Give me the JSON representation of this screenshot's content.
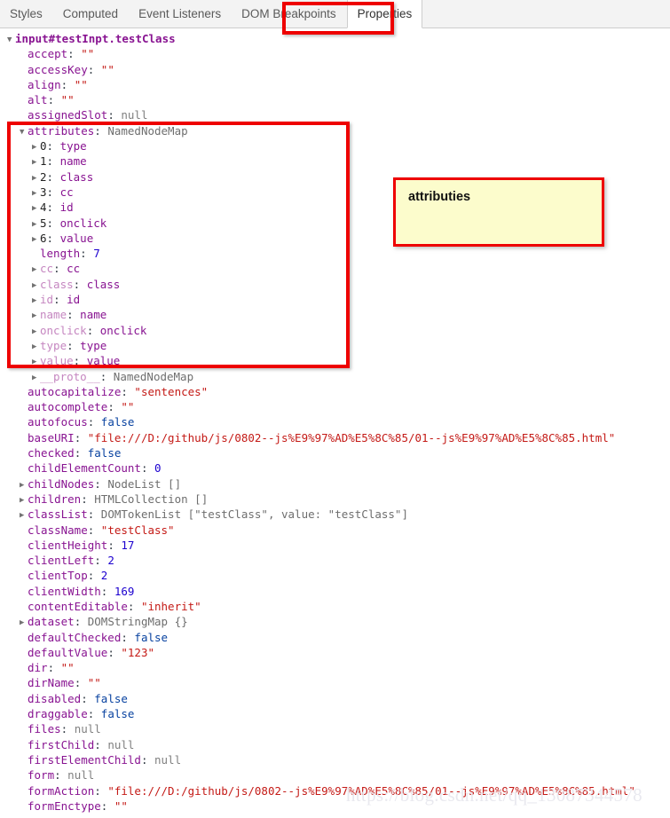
{
  "tabbar": {
    "tabs": [
      {
        "label": "Styles",
        "active": false
      },
      {
        "label": "Computed",
        "active": false
      },
      {
        "label": "Event Listeners",
        "active": false
      },
      {
        "label": "DOM Breakpoints",
        "active": false
      },
      {
        "label": "Properties",
        "active": true
      }
    ]
  },
  "note": {
    "text": "attributies"
  },
  "watermark": {
    "text": "https://blog.csdn.net/qq_13087344578"
  },
  "colors": {
    "annotation_red": "#ee0000",
    "note_fill": "#fcfccc",
    "key_purple": "#881391",
    "string_red": "#c41a16",
    "number_blue": "#1c00cf",
    "boolean_blue": "#0842a0",
    "null_gray": "#808080"
  },
  "tree": {
    "root": {
      "arrow": "open",
      "label": "input#testInpt.testClass"
    },
    "rows": [
      {
        "arrow": "none",
        "indent": 1,
        "keyClass": "k-name",
        "key": "accept",
        "sep": ": ",
        "valClass": "v-str",
        "val": "\"\""
      },
      {
        "arrow": "none",
        "indent": 1,
        "keyClass": "k-name",
        "key": "accessKey",
        "sep": ": ",
        "valClass": "v-str",
        "val": "\"\""
      },
      {
        "arrow": "none",
        "indent": 1,
        "keyClass": "k-name",
        "key": "align",
        "sep": ": ",
        "valClass": "v-str",
        "val": "\"\""
      },
      {
        "arrow": "none",
        "indent": 1,
        "keyClass": "k-name",
        "key": "alt",
        "sep": ": ",
        "valClass": "v-str",
        "val": "\"\""
      },
      {
        "arrow": "none",
        "indent": 1,
        "keyClass": "k-name",
        "key": "assignedSlot",
        "sep": ": ",
        "valClass": "v-null",
        "val": "null"
      },
      {
        "arrow": "open",
        "indent": 1,
        "keyClass": "k-name",
        "key": "attributes",
        "sep": ": ",
        "valClass": "v-obj",
        "val": "NamedNodeMap"
      },
      {
        "arrow": "closed",
        "indent": 2,
        "keyClass": "k-index",
        "key": "0",
        "sep": ": ",
        "valClass": "k-name",
        "val": "type"
      },
      {
        "arrow": "closed",
        "indent": 2,
        "keyClass": "k-index",
        "key": "1",
        "sep": ": ",
        "valClass": "k-name",
        "val": "name"
      },
      {
        "arrow": "closed",
        "indent": 2,
        "keyClass": "k-index",
        "key": "2",
        "sep": ": ",
        "valClass": "k-name",
        "val": "class"
      },
      {
        "arrow": "closed",
        "indent": 2,
        "keyClass": "k-index",
        "key": "3",
        "sep": ": ",
        "valClass": "k-name",
        "val": "cc"
      },
      {
        "arrow": "closed",
        "indent": 2,
        "keyClass": "k-index",
        "key": "4",
        "sep": ": ",
        "valClass": "k-name",
        "val": "id"
      },
      {
        "arrow": "closed",
        "indent": 2,
        "keyClass": "k-index",
        "key": "5",
        "sep": ": ",
        "valClass": "k-name",
        "val": "onclick"
      },
      {
        "arrow": "closed",
        "indent": 2,
        "keyClass": "k-index",
        "key": "6",
        "sep": ": ",
        "valClass": "k-name",
        "val": "value"
      },
      {
        "arrow": "none",
        "indent": 2,
        "keyClass": "k-name",
        "key": "length",
        "sep": ": ",
        "valClass": "v-num",
        "val": "7"
      },
      {
        "arrow": "closed",
        "indent": 2,
        "keyClass": "k-faded",
        "key": "cc",
        "sep": ": ",
        "valClass": "k-name",
        "val": "cc"
      },
      {
        "arrow": "closed",
        "indent": 2,
        "keyClass": "k-faded",
        "key": "class",
        "sep": ": ",
        "valClass": "k-name",
        "val": "class"
      },
      {
        "arrow": "closed",
        "indent": 2,
        "keyClass": "k-faded",
        "key": "id",
        "sep": ": ",
        "valClass": "k-name",
        "val": "id"
      },
      {
        "arrow": "closed",
        "indent": 2,
        "keyClass": "k-faded",
        "key": "name",
        "sep": ": ",
        "valClass": "k-name",
        "val": "name"
      },
      {
        "arrow": "closed",
        "indent": 2,
        "keyClass": "k-faded",
        "key": "onclick",
        "sep": ": ",
        "valClass": "k-name",
        "val": "onclick"
      },
      {
        "arrow": "closed",
        "indent": 2,
        "keyClass": "k-faded",
        "key": "type",
        "sep": ": ",
        "valClass": "k-name",
        "val": "type"
      },
      {
        "arrow": "closed",
        "indent": 2,
        "keyClass": "k-faded",
        "key": "value",
        "sep": ": ",
        "valClass": "k-name",
        "val": "value"
      },
      {
        "arrow": "closed",
        "indent": 2,
        "keyClass": "k-faded",
        "key": "__proto__",
        "sep": ": ",
        "valClass": "v-obj",
        "val": "NamedNodeMap"
      },
      {
        "arrow": "none",
        "indent": 1,
        "keyClass": "k-name",
        "key": "autocapitalize",
        "sep": ": ",
        "valClass": "v-str",
        "val": "\"sentences\""
      },
      {
        "arrow": "none",
        "indent": 1,
        "keyClass": "k-name",
        "key": "autocomplete",
        "sep": ": ",
        "valClass": "v-str",
        "val": "\"\""
      },
      {
        "arrow": "none",
        "indent": 1,
        "keyClass": "k-name",
        "key": "autofocus",
        "sep": ": ",
        "valClass": "v-bool",
        "val": "false"
      },
      {
        "arrow": "none",
        "indent": 1,
        "keyClass": "k-name",
        "key": "baseURI",
        "sep": ": ",
        "valClass": "v-str",
        "val": "\"file:///D:/github/js/0802--js%E9%97%AD%E5%8C%85/01--js%E9%97%AD%E5%8C%85.html\""
      },
      {
        "arrow": "none",
        "indent": 1,
        "keyClass": "k-name",
        "key": "checked",
        "sep": ": ",
        "valClass": "v-bool",
        "val": "false"
      },
      {
        "arrow": "none",
        "indent": 1,
        "keyClass": "k-name",
        "key": "childElementCount",
        "sep": ": ",
        "valClass": "v-num",
        "val": "0"
      },
      {
        "arrow": "closed",
        "indent": 1,
        "keyClass": "k-name",
        "key": "childNodes",
        "sep": ": ",
        "valClass": "v-obj",
        "val": "NodeList []"
      },
      {
        "arrow": "closed",
        "indent": 1,
        "keyClass": "k-name",
        "key": "children",
        "sep": ": ",
        "valClass": "v-obj",
        "val": "HTMLCollection []"
      },
      {
        "arrow": "closed",
        "indent": 1,
        "keyClass": "k-name",
        "key": "classList",
        "sep": ": ",
        "valClass": "v-obj",
        "val": "DOMTokenList [\"testClass\", value: \"testClass\"]"
      },
      {
        "arrow": "none",
        "indent": 1,
        "keyClass": "k-name",
        "key": "className",
        "sep": ": ",
        "valClass": "v-str",
        "val": "\"testClass\""
      },
      {
        "arrow": "none",
        "indent": 1,
        "keyClass": "k-name",
        "key": "clientHeight",
        "sep": ": ",
        "valClass": "v-num",
        "val": "17"
      },
      {
        "arrow": "none",
        "indent": 1,
        "keyClass": "k-name",
        "key": "clientLeft",
        "sep": ": ",
        "valClass": "v-num",
        "val": "2"
      },
      {
        "arrow": "none",
        "indent": 1,
        "keyClass": "k-name",
        "key": "clientTop",
        "sep": ": ",
        "valClass": "v-num",
        "val": "2"
      },
      {
        "arrow": "none",
        "indent": 1,
        "keyClass": "k-name",
        "key": "clientWidth",
        "sep": ": ",
        "valClass": "v-num",
        "val": "169"
      },
      {
        "arrow": "none",
        "indent": 1,
        "keyClass": "k-name",
        "key": "contentEditable",
        "sep": ": ",
        "valClass": "v-str",
        "val": "\"inherit\""
      },
      {
        "arrow": "closed",
        "indent": 1,
        "keyClass": "k-name",
        "key": "dataset",
        "sep": ": ",
        "valClass": "v-obj",
        "val": "DOMStringMap {}"
      },
      {
        "arrow": "none",
        "indent": 1,
        "keyClass": "k-name",
        "key": "defaultChecked",
        "sep": ": ",
        "valClass": "v-bool",
        "val": "false"
      },
      {
        "arrow": "none",
        "indent": 1,
        "keyClass": "k-name",
        "key": "defaultValue",
        "sep": ": ",
        "valClass": "v-str",
        "val": "\"123\""
      },
      {
        "arrow": "none",
        "indent": 1,
        "keyClass": "k-name",
        "key": "dir",
        "sep": ": ",
        "valClass": "v-str",
        "val": "\"\""
      },
      {
        "arrow": "none",
        "indent": 1,
        "keyClass": "k-name",
        "key": "dirName",
        "sep": ": ",
        "valClass": "v-str",
        "val": "\"\""
      },
      {
        "arrow": "none",
        "indent": 1,
        "keyClass": "k-name",
        "key": "disabled",
        "sep": ": ",
        "valClass": "v-bool",
        "val": "false"
      },
      {
        "arrow": "none",
        "indent": 1,
        "keyClass": "k-name",
        "key": "draggable",
        "sep": ": ",
        "valClass": "v-bool",
        "val": "false"
      },
      {
        "arrow": "none",
        "indent": 1,
        "keyClass": "k-name",
        "key": "files",
        "sep": ": ",
        "valClass": "v-null",
        "val": "null"
      },
      {
        "arrow": "none",
        "indent": 1,
        "keyClass": "k-name",
        "key": "firstChild",
        "sep": ": ",
        "valClass": "v-null",
        "val": "null"
      },
      {
        "arrow": "none",
        "indent": 1,
        "keyClass": "k-name",
        "key": "firstElementChild",
        "sep": ": ",
        "valClass": "v-null",
        "val": "null"
      },
      {
        "arrow": "none",
        "indent": 1,
        "keyClass": "k-name",
        "key": "form",
        "sep": ": ",
        "valClass": "v-null",
        "val": "null"
      },
      {
        "arrow": "none",
        "indent": 1,
        "keyClass": "k-name",
        "key": "formAction",
        "sep": ": ",
        "valClass": "v-str",
        "val": "\"file:///D:/github/js/0802--js%E9%97%AD%E5%8C%85/01--js%E9%97%AD%E5%8C%85.html\""
      },
      {
        "arrow": "none",
        "indent": 1,
        "keyClass": "k-name",
        "key": "formEnctype",
        "sep": ": ",
        "valClass": "v-str",
        "val": "\"\""
      }
    ]
  }
}
